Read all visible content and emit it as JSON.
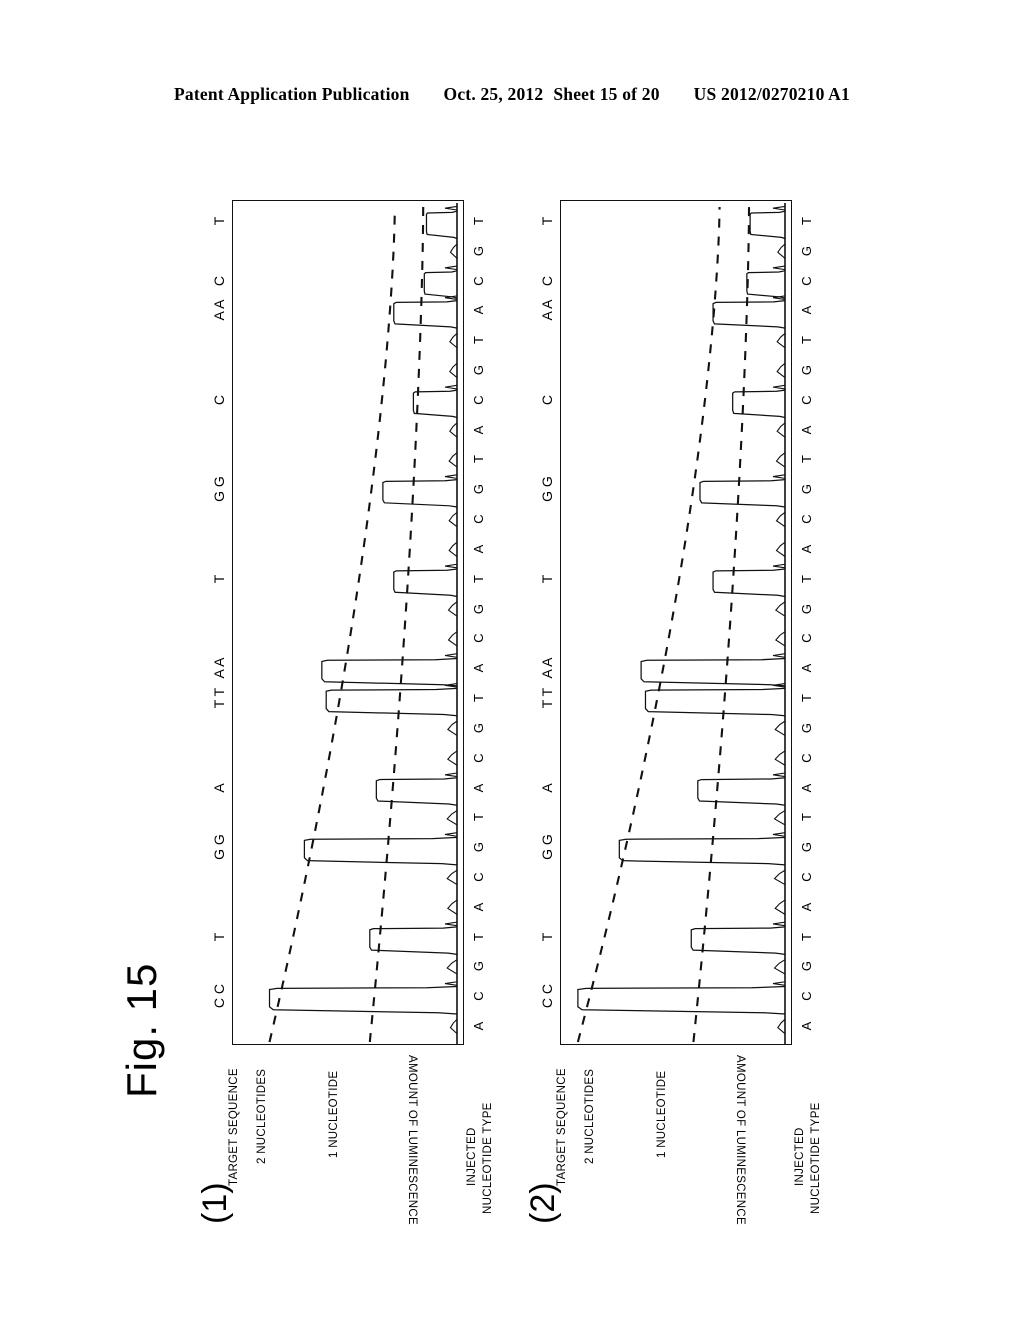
{
  "header": {
    "publication": "Patent Application Publication",
    "date": "Oct. 25, 2012",
    "sheet": "Sheet 15 of 20",
    "docnum": "US 2012/0270210 A1"
  },
  "figure": {
    "label": "Fig. 15"
  },
  "labels": {
    "target_sequence": "TARGET SEQUENCE",
    "two_nucleotides": "2 NUCLEOTIDES",
    "one_nucleotide": "1 NUCLEOTIDE",
    "amount_of_luminescence": "AMOUNT OF LUMINESCENCE",
    "injected_line1": "INJECTED",
    "injected_line2": "NUCLEOTIDE TYPE"
  },
  "panels": [
    {
      "number": "(1)"
    },
    {
      "number": "(2)"
    }
  ],
  "chart_data": [
    {
      "type": "line",
      "title": "Fig. 15 (1) Pyrogram",
      "xlabel": "INJECTED NUCLEOTIDE TYPE",
      "ylabel": "AMOUNT OF LUMINESCENCE",
      "orientation": "rotated-90",
      "grid": false,
      "legend": [
        "1 NUCLEOTIDE",
        "2 NUCLEOTIDES"
      ],
      "legend_position": "left-axis-annotations",
      "xlim": [
        0,
        28
      ],
      "ylim": [
        0,
        1.0
      ],
      "injected_sequence": [
        "A",
        "C",
        "G",
        "T",
        "A",
        "C",
        "G",
        "T",
        "A",
        "C",
        "G",
        "T",
        "A",
        "C",
        "G",
        "T",
        "A",
        "C",
        "G",
        "T",
        "A",
        "C",
        "G",
        "T",
        "A",
        "C",
        "G",
        "T"
      ],
      "target_sequence": [
        "CC",
        "T",
        "GG",
        "A",
        "TT",
        "AA",
        "T",
        "GG",
        "C",
        "AA",
        "C",
        "T",
        "AA",
        "T"
      ],
      "target_sequence_positions": [
        1,
        3,
        6,
        8,
        11,
        12,
        15,
        18,
        21,
        24,
        25,
        27,
        30,
        33
      ],
      "reference_levels": {
        "one_nucleotide_start": 0.4,
        "one_nucleotide_end": 0.155,
        "two_nucleotides_start": 0.86,
        "two_nucleotides_end": 0.285
      },
      "peaks": [
        {
          "index": 0,
          "injected": "A",
          "incorporated": "",
          "height": 0.02
        },
        {
          "index": 1,
          "injected": "C",
          "incorporated": "CC",
          "height": 0.86
        },
        {
          "index": 2,
          "injected": "G",
          "incorporated": "",
          "height": 0.03
        },
        {
          "index": 3,
          "injected": "T",
          "incorporated": "T",
          "height": 0.4
        },
        {
          "index": 4,
          "injected": "A",
          "incorporated": "",
          "height": 0.028
        },
        {
          "index": 5,
          "injected": "C",
          "incorporated": "",
          "height": 0.03
        },
        {
          "index": 6,
          "injected": "G",
          "incorporated": "GG",
          "height": 0.7
        },
        {
          "index": 7,
          "injected": "T",
          "incorporated": "",
          "height": 0.03
        },
        {
          "index": 8,
          "injected": "A",
          "incorporated": "A",
          "height": 0.37
        },
        {
          "index": 9,
          "injected": "C",
          "incorporated": "",
          "height": 0.028
        },
        {
          "index": 10,
          "injected": "G",
          "incorporated": "",
          "height": 0.028
        },
        {
          "index": 11,
          "injected": "T",
          "incorporated": "TT",
          "height": 0.6
        },
        {
          "index": 12,
          "injected": "A",
          "incorporated": "AA",
          "height": 0.62
        },
        {
          "index": 13,
          "injected": "C",
          "incorporated": "",
          "height": 0.026
        },
        {
          "index": 14,
          "injected": "G",
          "incorporated": "",
          "height": 0.026
        },
        {
          "index": 15,
          "injected": "T",
          "incorporated": "T",
          "height": 0.29
        },
        {
          "index": 16,
          "injected": "A",
          "incorporated": "",
          "height": 0.024
        },
        {
          "index": 17,
          "injected": "C",
          "incorporated": "",
          "height": 0.024
        },
        {
          "index": 18,
          "injected": "G",
          "incorporated": "GG",
          "height": 0.34
        },
        {
          "index": 19,
          "injected": "T",
          "incorporated": "",
          "height": 0.024
        },
        {
          "index": 20,
          "injected": "A",
          "incorporated": "",
          "height": 0.022
        },
        {
          "index": 21,
          "injected": "C",
          "incorporated": "C",
          "height": 0.2
        },
        {
          "index": 22,
          "injected": "G",
          "incorporated": "",
          "height": 0.022
        },
        {
          "index": 23,
          "injected": "T",
          "incorporated": "",
          "height": 0.022
        },
        {
          "index": 24,
          "injected": "A",
          "incorporated": "AA",
          "height": 0.29
        },
        {
          "index": 25,
          "injected": "C",
          "incorporated": "C",
          "height": 0.15
        },
        {
          "index": 26,
          "injected": "G",
          "incorporated": "",
          "height": 0.02
        },
        {
          "index": 27,
          "injected": "T",
          "incorporated": "T",
          "height": 0.14
        }
      ]
    },
    {
      "type": "line",
      "title": "Fig. 15 (2) Pyrogram",
      "xlabel": "INJECTED NUCLEOTIDE TYPE",
      "ylabel": "AMOUNT OF LUMINESCENCE",
      "orientation": "rotated-90",
      "grid": false,
      "legend": [
        "1 NUCLEOTIDE",
        "2 NUCLEOTIDES"
      ],
      "legend_position": "left-axis-annotations",
      "xlim": [
        0,
        28
      ],
      "ylim": [
        0,
        1.0
      ],
      "injected_sequence": [
        "A",
        "C",
        "G",
        "T",
        "A",
        "C",
        "G",
        "T",
        "A",
        "C",
        "G",
        "T",
        "A",
        "C",
        "G",
        "T",
        "A",
        "C",
        "G",
        "T",
        "A",
        "C",
        "G",
        "T",
        "A",
        "C",
        "G",
        "T"
      ],
      "target_sequence": [
        "CC",
        "T",
        "GG",
        "A",
        "TT",
        "AA",
        "T",
        "GG",
        "C",
        "AA",
        "C",
        "T",
        "AA",
        "T"
      ],
      "target_sequence_positions": [
        1,
        3,
        6,
        8,
        11,
        12,
        15,
        18,
        21,
        24,
        25,
        27,
        30,
        33
      ],
      "reference_levels": {
        "one_nucleotide_start": 0.42,
        "one_nucleotide_end": 0.165,
        "two_nucleotides_start": 0.95,
        "two_nucleotides_end": 0.3
      },
      "peaks": [
        {
          "index": 0,
          "injected": "A",
          "incorporated": "",
          "height": 0.022
        },
        {
          "index": 1,
          "injected": "C",
          "incorporated": "CC",
          "height": 0.95
        },
        {
          "index": 2,
          "injected": "G",
          "incorporated": "",
          "height": 0.032
        },
        {
          "index": 3,
          "injected": "T",
          "incorporated": "T",
          "height": 0.43
        },
        {
          "index": 4,
          "injected": "A",
          "incorporated": "",
          "height": 0.03
        },
        {
          "index": 5,
          "injected": "C",
          "incorporated": "",
          "height": 0.032
        },
        {
          "index": 6,
          "injected": "G",
          "incorporated": "GG",
          "height": 0.76
        },
        {
          "index": 7,
          "injected": "T",
          "incorporated": "",
          "height": 0.032
        },
        {
          "index": 8,
          "injected": "A",
          "incorporated": "A",
          "height": 0.4
        },
        {
          "index": 9,
          "injected": "C",
          "incorporated": "",
          "height": 0.03
        },
        {
          "index": 10,
          "injected": "G",
          "incorporated": "",
          "height": 0.03
        },
        {
          "index": 11,
          "injected": "T",
          "incorporated": "TT",
          "height": 0.64
        },
        {
          "index": 12,
          "injected": "A",
          "incorporated": "AA",
          "height": 0.66
        },
        {
          "index": 13,
          "injected": "C",
          "incorporated": "",
          "height": 0.028
        },
        {
          "index": 14,
          "injected": "G",
          "incorporated": "",
          "height": 0.028
        },
        {
          "index": 15,
          "injected": "T",
          "incorporated": "T",
          "height": 0.33
        },
        {
          "index": 16,
          "injected": "A",
          "incorporated": "",
          "height": 0.026
        },
        {
          "index": 17,
          "injected": "C",
          "incorporated": "",
          "height": 0.026
        },
        {
          "index": 18,
          "injected": "G",
          "incorporated": "GG",
          "height": 0.39
        },
        {
          "index": 19,
          "injected": "T",
          "incorporated": "",
          "height": 0.026
        },
        {
          "index": 20,
          "injected": "A",
          "incorporated": "",
          "height": 0.024
        },
        {
          "index": 21,
          "injected": "C",
          "incorporated": "C",
          "height": 0.24
        },
        {
          "index": 22,
          "injected": "G",
          "incorporated": "",
          "height": 0.024
        },
        {
          "index": 23,
          "injected": "T",
          "incorporated": "",
          "height": 0.024
        },
        {
          "index": 24,
          "injected": "A",
          "incorporated": "AA",
          "height": 0.33
        },
        {
          "index": 25,
          "injected": "C",
          "incorporated": "C",
          "height": 0.175
        },
        {
          "index": 26,
          "injected": "G",
          "incorporated": "",
          "height": 0.022
        },
        {
          "index": 27,
          "injected": "T",
          "incorporated": "T",
          "height": 0.16
        }
      ]
    }
  ],
  "style": {
    "ink": "#111111",
    "paper": "#ffffff"
  }
}
